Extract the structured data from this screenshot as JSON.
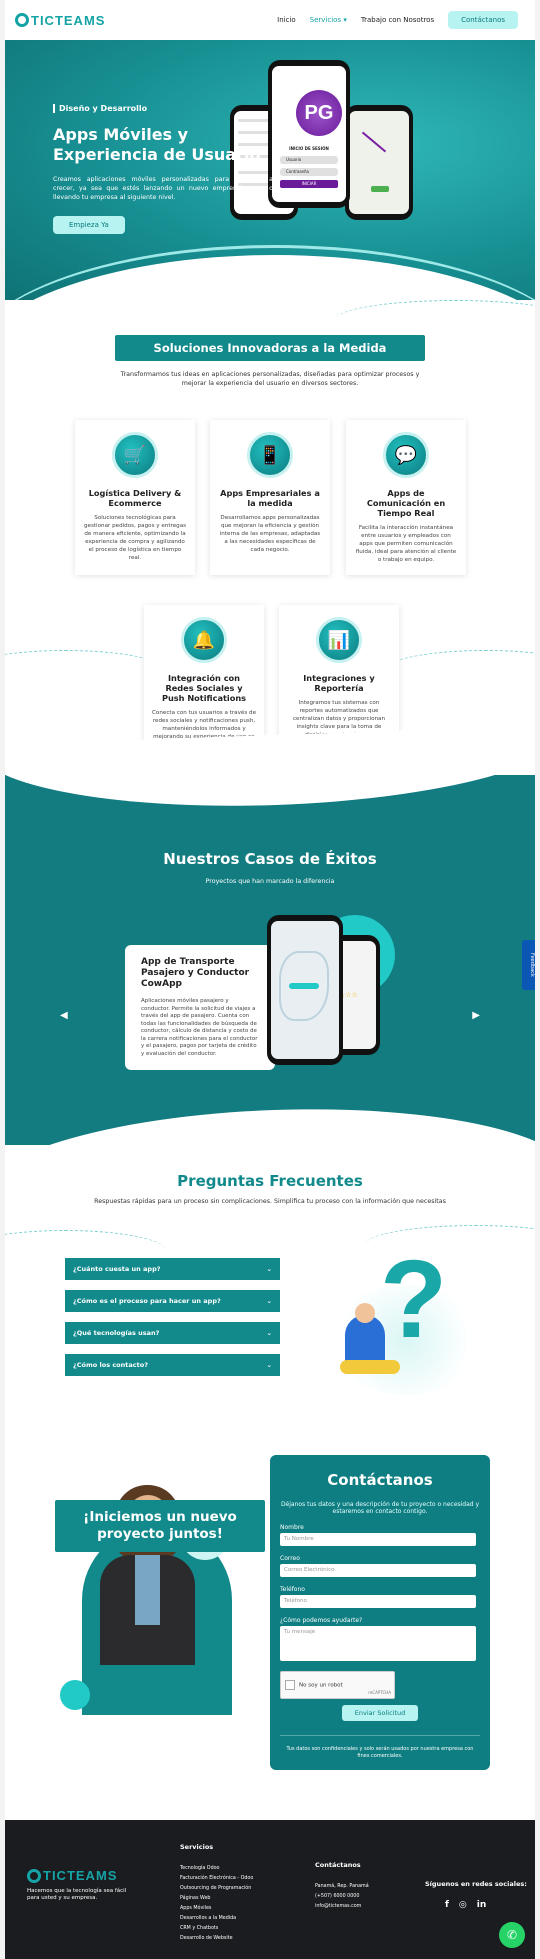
{
  "brand": {
    "name": "TICTEAMS",
    "accent": "#15a3a6",
    "dark": "#128a8c"
  },
  "nav": {
    "items": [
      "Inicio",
      "Servicios",
      "Trabajo con Nosotros"
    ],
    "active": "Servicios",
    "cta": "Contáctanos"
  },
  "hero": {
    "eyebrow": "Diseño y Desarrollo",
    "title": "Apps Móviles y Experiencia de Usuario",
    "text": "Creamos aplicaciones móviles personalizadas para ayudarte a crecer, ya sea que estés lanzando un nuevo emprendimiento o llevando tu empresa al siguiente nivel.",
    "button": "Empieza Ya",
    "phone_login_title": "INICIO DE SESIÓN",
    "phone_user": "Usuario",
    "phone_pass": "Contraseña",
    "phone_btn": "INICIAR",
    "phone_logo": "PG"
  },
  "solutions": {
    "title": "Soluciones Innovadoras a la Medida",
    "desc": "Transformamos tus ideas en aplicaciones personalizadas, diseñadas para optimizar procesos y mejorar la experiencia del usuario en diversos sectores.",
    "cards": [
      {
        "title": "Logística Delivery & Ecommerce",
        "text": "Soluciones tecnológicas para gestionar pedidos, pagos y entregas de manera eficiente, optimizando la experiencia de compra y agilizando el proceso de logística en tiempo real.",
        "icon": "delivery-icon"
      },
      {
        "title": "Apps Empresariales a la medida",
        "text": "Desarrollamos apps personalizadas que mejoran la eficiencia y gestión interna de las empresas, adaptadas a las necesidades específicas de cada negocio.",
        "icon": "enterprise-app-icon"
      },
      {
        "title": "Apps de Comunicación en Tiempo Real",
        "text": "Facilita la interacción instantánea entre usuarios y empleados con apps que permiten comunicación fluida, ideal para atención al cliente o trabajo en equipo.",
        "icon": "chat-icon"
      },
      {
        "title": "Integración con Redes Sociales y Push Notifications",
        "text": "Conecta con tus usuarios a través de redes sociales y notificaciones push, manteniéndolos informados y mejorando su experiencia de uso en tiempo real.",
        "icon": "social-push-icon"
      },
      {
        "title": "Integraciones y Reportería",
        "text": "Integramos tus sistemas con reportes automatizados que centralizan datos y proporcionan insights clave para la toma de decisiones estratégicas.",
        "icon": "reports-icon"
      }
    ]
  },
  "cases": {
    "title": "Nuestros Casos de Éxitos",
    "subtitle": "Proyectos que han marcado la diferencia",
    "card_title": "App de Transporte Pasajero y Conductor CowApp",
    "card_text": "Aplicaciones móviles pasajero y conductor. Permite la solicitud de viajes a través del app de pasajero. Cuenta con todas las funcionalidades de búsqueda de conductor, cálculo de distancia y costo de la carrera notificaciones para el conductor y el pasajero, pagos por tarjeta de crédito y evaluación del conductor."
  },
  "feedback": "Feedback",
  "faq": {
    "title": "Preguntas Frecuentes",
    "subtitle": "Respuestas rápidas para un proceso sin complicaciones. Simplifica tu proceso con la información que necesitas",
    "items": [
      "¿Cuánto cuesta un app?",
      "¿Cómo es el proceso para hacer un app?",
      "¿Qué tecnologías usan?",
      "¿Cómo los contacto?"
    ]
  },
  "contact": {
    "banner": "¡Iniciemos un nuevo proyecto juntos!",
    "title": "Contáctanos",
    "desc": "Déjanos tus datos y una descripción de tu proyecto o necesidad y estaremos en contacto contigo.",
    "fields": [
      {
        "label": "Nombre",
        "placeholder": "Tu Nombre"
      },
      {
        "label": "Correo",
        "placeholder": "Correo Electrónico"
      },
      {
        "label": "Teléfono",
        "placeholder": "Teléfono"
      }
    ],
    "message_label": "¿Cómo podemos ayudarte?",
    "message_placeholder": "Tu mensaje",
    "captcha": "No soy un robot",
    "captcha_brand": "reCAPTCHA",
    "submit": "Enviar Solicitud",
    "note": "Tus datos son confidenciales y solo serán usados por nuestra empresa con fines comerciales."
  },
  "footer": {
    "tagline": "Hacemos que la tecnología sea fácil para usted y su empresa.",
    "services_title": "Servicios",
    "services": [
      "Tecnología Odoo",
      "Facturación Electrónica - Odoo",
      "Outsourcing de Programación",
      "Páginas Web",
      "Apps Móviles",
      "Desarrollos a la Medida",
      "CRM y Chatbots",
      "Desarrollo de Website"
    ],
    "contact_title": "Contáctanos",
    "contact": [
      "Panamá, Rep. Panamá",
      "(+507) 6000 0000",
      "info@tictemas.com"
    ],
    "social_title": "Síguenos en redes sociales:",
    "social": [
      "f",
      "◎",
      "in"
    ]
  }
}
